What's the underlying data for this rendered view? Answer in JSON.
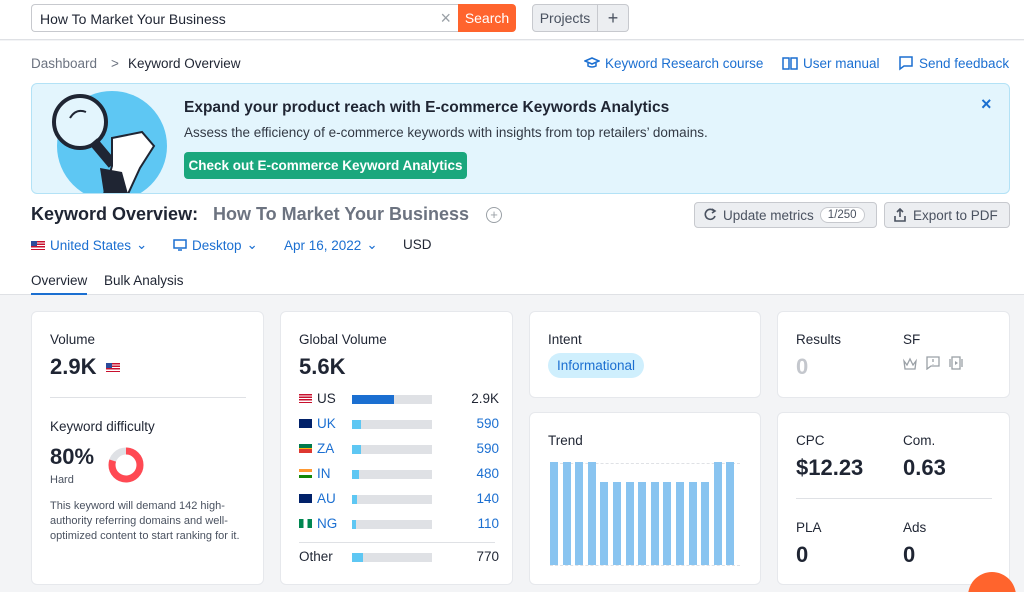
{
  "search": {
    "query": "How To Market Your Business",
    "button": "Search",
    "projects": "Projects",
    "plus": "+"
  },
  "breadcrumb": {
    "dashboard": "Dashboard",
    "separator": ">",
    "current": "Keyword Overview"
  },
  "header_links": {
    "course": "Keyword Research course",
    "manual": "User manual",
    "feedback": "Send feedback"
  },
  "banner": {
    "title": "Expand your product reach with E-commerce Keywords Analytics",
    "subtitle": "Assess the efficiency of e-commerce keywords with insights from top retailers’ domains.",
    "button": "Check out E-commerce Keyword Analytics",
    "close": "×"
  },
  "title": {
    "label": "Keyword Overview:",
    "phrase": "How To Market Your Business"
  },
  "actions": {
    "update": "Update metrics",
    "update_count": "1/250",
    "export": "Export to PDF"
  },
  "filters": {
    "country": "United States",
    "device": "Desktop",
    "date": "Apr 16, 2022",
    "currency": "USD"
  },
  "tabs": {
    "overview": "Overview",
    "bulk": "Bulk Analysis"
  },
  "volume_card": {
    "label": "Volume",
    "value": "2.9K",
    "kd_label": "Keyword difficulty",
    "kd_value": "80%",
    "kd_level": "Hard",
    "kd_fraction": 0.8,
    "kd_note": "This keyword will demand 142 high-authority referring domains and well-optimized content to start ranking for it."
  },
  "global_card": {
    "label": "Global Volume",
    "value": "5.6K",
    "rows": [
      {
        "code": "US",
        "value": "2.9K",
        "fraction": 0.52
      },
      {
        "code": "UK",
        "value": "590",
        "fraction": 0.11
      },
      {
        "code": "ZA",
        "value": "590",
        "fraction": 0.11
      },
      {
        "code": "IN",
        "value": "480",
        "fraction": 0.09
      },
      {
        "code": "AU",
        "value": "140",
        "fraction": 0.06
      },
      {
        "code": "NG",
        "value": "110",
        "fraction": 0.05
      }
    ],
    "other": {
      "code": "Other",
      "value": "770",
      "fraction": 0.14
    }
  },
  "intent_card": {
    "label": "Intent",
    "value": "Informational"
  },
  "trend_card": {
    "label": "Trend",
    "values": [
      1,
      1,
      1,
      1,
      0.81,
      0.81,
      0.81,
      0.81,
      0.81,
      0.81,
      0.81,
      0.81,
      0.81,
      1,
      1
    ]
  },
  "results_card": {
    "results_label": "Results",
    "results_value": "0",
    "sf_label": "SF"
  },
  "cpc_card": {
    "cpc_label": "CPC",
    "cpc_value": "$12.23",
    "com_label": "Com.",
    "com_value": "0.63",
    "pla_label": "PLA",
    "pla_value": "0",
    "ads_label": "Ads",
    "ads_value": "0"
  },
  "colors": {
    "accent": "#1b6fd1",
    "search": "#ff642d",
    "cta": "#1aa77d",
    "kd_red": "#ff4953"
  }
}
